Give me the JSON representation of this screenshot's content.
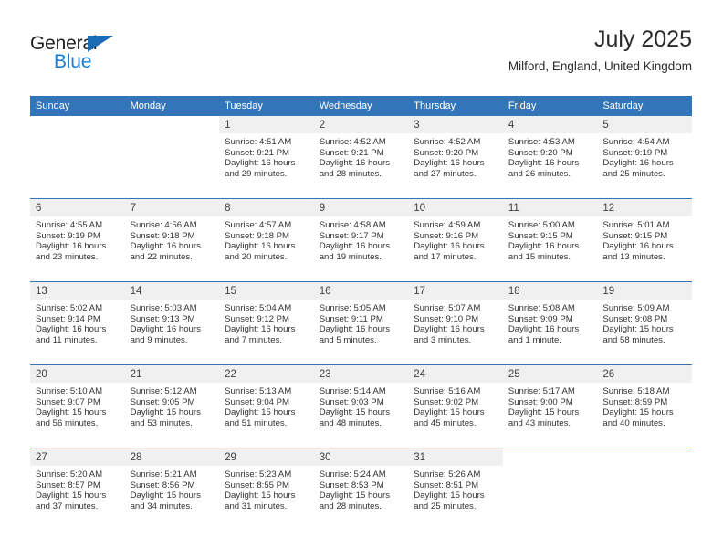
{
  "logo": {
    "word_one": "General",
    "word_two": "Blue",
    "triangle_icon": "blue-triangle-icon",
    "colors": {
      "dark": "#231f20",
      "blue": "#1b7fd4",
      "triangle": "#1b6cb5"
    }
  },
  "header": {
    "title": "July 2025",
    "subtitle": "Milford, England, United Kingdom"
  },
  "theme": {
    "header_bar": "#3375b9",
    "daynum_strip": "#f0f0f0",
    "row_divider": "#3375b9",
    "text": "#333333"
  },
  "weekday_headers": [
    "Sunday",
    "Monday",
    "Tuesday",
    "Wednesday",
    "Thursday",
    "Friday",
    "Saturday"
  ],
  "weeks": [
    [
      {
        "day": "",
        "empty": true
      },
      {
        "day": "",
        "empty": true
      },
      {
        "day": "1",
        "sunrise": "Sunrise: 4:51 AM",
        "sunset": "Sunset: 9:21 PM",
        "daylight_line1": "Daylight: 16 hours",
        "daylight_line2": "and 29 minutes."
      },
      {
        "day": "2",
        "sunrise": "Sunrise: 4:52 AM",
        "sunset": "Sunset: 9:21 PM",
        "daylight_line1": "Daylight: 16 hours",
        "daylight_line2": "and 28 minutes."
      },
      {
        "day": "3",
        "sunrise": "Sunrise: 4:52 AM",
        "sunset": "Sunset: 9:20 PM",
        "daylight_line1": "Daylight: 16 hours",
        "daylight_line2": "and 27 minutes."
      },
      {
        "day": "4",
        "sunrise": "Sunrise: 4:53 AM",
        "sunset": "Sunset: 9:20 PM",
        "daylight_line1": "Daylight: 16 hours",
        "daylight_line2": "and 26 minutes."
      },
      {
        "day": "5",
        "sunrise": "Sunrise: 4:54 AM",
        "sunset": "Sunset: 9:19 PM",
        "daylight_line1": "Daylight: 16 hours",
        "daylight_line2": "and 25 minutes."
      }
    ],
    [
      {
        "day": "6",
        "sunrise": "Sunrise: 4:55 AM",
        "sunset": "Sunset: 9:19 PM",
        "daylight_line1": "Daylight: 16 hours",
        "daylight_line2": "and 23 minutes."
      },
      {
        "day": "7",
        "sunrise": "Sunrise: 4:56 AM",
        "sunset": "Sunset: 9:18 PM",
        "daylight_line1": "Daylight: 16 hours",
        "daylight_line2": "and 22 minutes."
      },
      {
        "day": "8",
        "sunrise": "Sunrise: 4:57 AM",
        "sunset": "Sunset: 9:18 PM",
        "daylight_line1": "Daylight: 16 hours",
        "daylight_line2": "and 20 minutes."
      },
      {
        "day": "9",
        "sunrise": "Sunrise: 4:58 AM",
        "sunset": "Sunset: 9:17 PM",
        "daylight_line1": "Daylight: 16 hours",
        "daylight_line2": "and 19 minutes."
      },
      {
        "day": "10",
        "sunrise": "Sunrise: 4:59 AM",
        "sunset": "Sunset: 9:16 PM",
        "daylight_line1": "Daylight: 16 hours",
        "daylight_line2": "and 17 minutes."
      },
      {
        "day": "11",
        "sunrise": "Sunrise: 5:00 AM",
        "sunset": "Sunset: 9:15 PM",
        "daylight_line1": "Daylight: 16 hours",
        "daylight_line2": "and 15 minutes."
      },
      {
        "day": "12",
        "sunrise": "Sunrise: 5:01 AM",
        "sunset": "Sunset: 9:15 PM",
        "daylight_line1": "Daylight: 16 hours",
        "daylight_line2": "and 13 minutes."
      }
    ],
    [
      {
        "day": "13",
        "sunrise": "Sunrise: 5:02 AM",
        "sunset": "Sunset: 9:14 PM",
        "daylight_line1": "Daylight: 16 hours",
        "daylight_line2": "and 11 minutes."
      },
      {
        "day": "14",
        "sunrise": "Sunrise: 5:03 AM",
        "sunset": "Sunset: 9:13 PM",
        "daylight_line1": "Daylight: 16 hours",
        "daylight_line2": "and 9 minutes."
      },
      {
        "day": "15",
        "sunrise": "Sunrise: 5:04 AM",
        "sunset": "Sunset: 9:12 PM",
        "daylight_line1": "Daylight: 16 hours",
        "daylight_line2": "and 7 minutes."
      },
      {
        "day": "16",
        "sunrise": "Sunrise: 5:05 AM",
        "sunset": "Sunset: 9:11 PM",
        "daylight_line1": "Daylight: 16 hours",
        "daylight_line2": "and 5 minutes."
      },
      {
        "day": "17",
        "sunrise": "Sunrise: 5:07 AM",
        "sunset": "Sunset: 9:10 PM",
        "daylight_line1": "Daylight: 16 hours",
        "daylight_line2": "and 3 minutes."
      },
      {
        "day": "18",
        "sunrise": "Sunrise: 5:08 AM",
        "sunset": "Sunset: 9:09 PM",
        "daylight_line1": "Daylight: 16 hours",
        "daylight_line2": "and 1 minute."
      },
      {
        "day": "19",
        "sunrise": "Sunrise: 5:09 AM",
        "sunset": "Sunset: 9:08 PM",
        "daylight_line1": "Daylight: 15 hours",
        "daylight_line2": "and 58 minutes."
      }
    ],
    [
      {
        "day": "20",
        "sunrise": "Sunrise: 5:10 AM",
        "sunset": "Sunset: 9:07 PM",
        "daylight_line1": "Daylight: 15 hours",
        "daylight_line2": "and 56 minutes."
      },
      {
        "day": "21",
        "sunrise": "Sunrise: 5:12 AM",
        "sunset": "Sunset: 9:05 PM",
        "daylight_line1": "Daylight: 15 hours",
        "daylight_line2": "and 53 minutes."
      },
      {
        "day": "22",
        "sunrise": "Sunrise: 5:13 AM",
        "sunset": "Sunset: 9:04 PM",
        "daylight_line1": "Daylight: 15 hours",
        "daylight_line2": "and 51 minutes."
      },
      {
        "day": "23",
        "sunrise": "Sunrise: 5:14 AM",
        "sunset": "Sunset: 9:03 PM",
        "daylight_line1": "Daylight: 15 hours",
        "daylight_line2": "and 48 minutes."
      },
      {
        "day": "24",
        "sunrise": "Sunrise: 5:16 AM",
        "sunset": "Sunset: 9:02 PM",
        "daylight_line1": "Daylight: 15 hours",
        "daylight_line2": "and 45 minutes."
      },
      {
        "day": "25",
        "sunrise": "Sunrise: 5:17 AM",
        "sunset": "Sunset: 9:00 PM",
        "daylight_line1": "Daylight: 15 hours",
        "daylight_line2": "and 43 minutes."
      },
      {
        "day": "26",
        "sunrise": "Sunrise: 5:18 AM",
        "sunset": "Sunset: 8:59 PM",
        "daylight_line1": "Daylight: 15 hours",
        "daylight_line2": "and 40 minutes."
      }
    ],
    [
      {
        "day": "27",
        "sunrise": "Sunrise: 5:20 AM",
        "sunset": "Sunset: 8:57 PM",
        "daylight_line1": "Daylight: 15 hours",
        "daylight_line2": "and 37 minutes."
      },
      {
        "day": "28",
        "sunrise": "Sunrise: 5:21 AM",
        "sunset": "Sunset: 8:56 PM",
        "daylight_line1": "Daylight: 15 hours",
        "daylight_line2": "and 34 minutes."
      },
      {
        "day": "29",
        "sunrise": "Sunrise: 5:23 AM",
        "sunset": "Sunset: 8:55 PM",
        "daylight_line1": "Daylight: 15 hours",
        "daylight_line2": "and 31 minutes."
      },
      {
        "day": "30",
        "sunrise": "Sunrise: 5:24 AM",
        "sunset": "Sunset: 8:53 PM",
        "daylight_line1": "Daylight: 15 hours",
        "daylight_line2": "and 28 minutes."
      },
      {
        "day": "31",
        "sunrise": "Sunrise: 5:26 AM",
        "sunset": "Sunset: 8:51 PM",
        "daylight_line1": "Daylight: 15 hours",
        "daylight_line2": "and 25 minutes."
      },
      {
        "day": "",
        "empty": true
      },
      {
        "day": "",
        "empty": true
      }
    ]
  ]
}
